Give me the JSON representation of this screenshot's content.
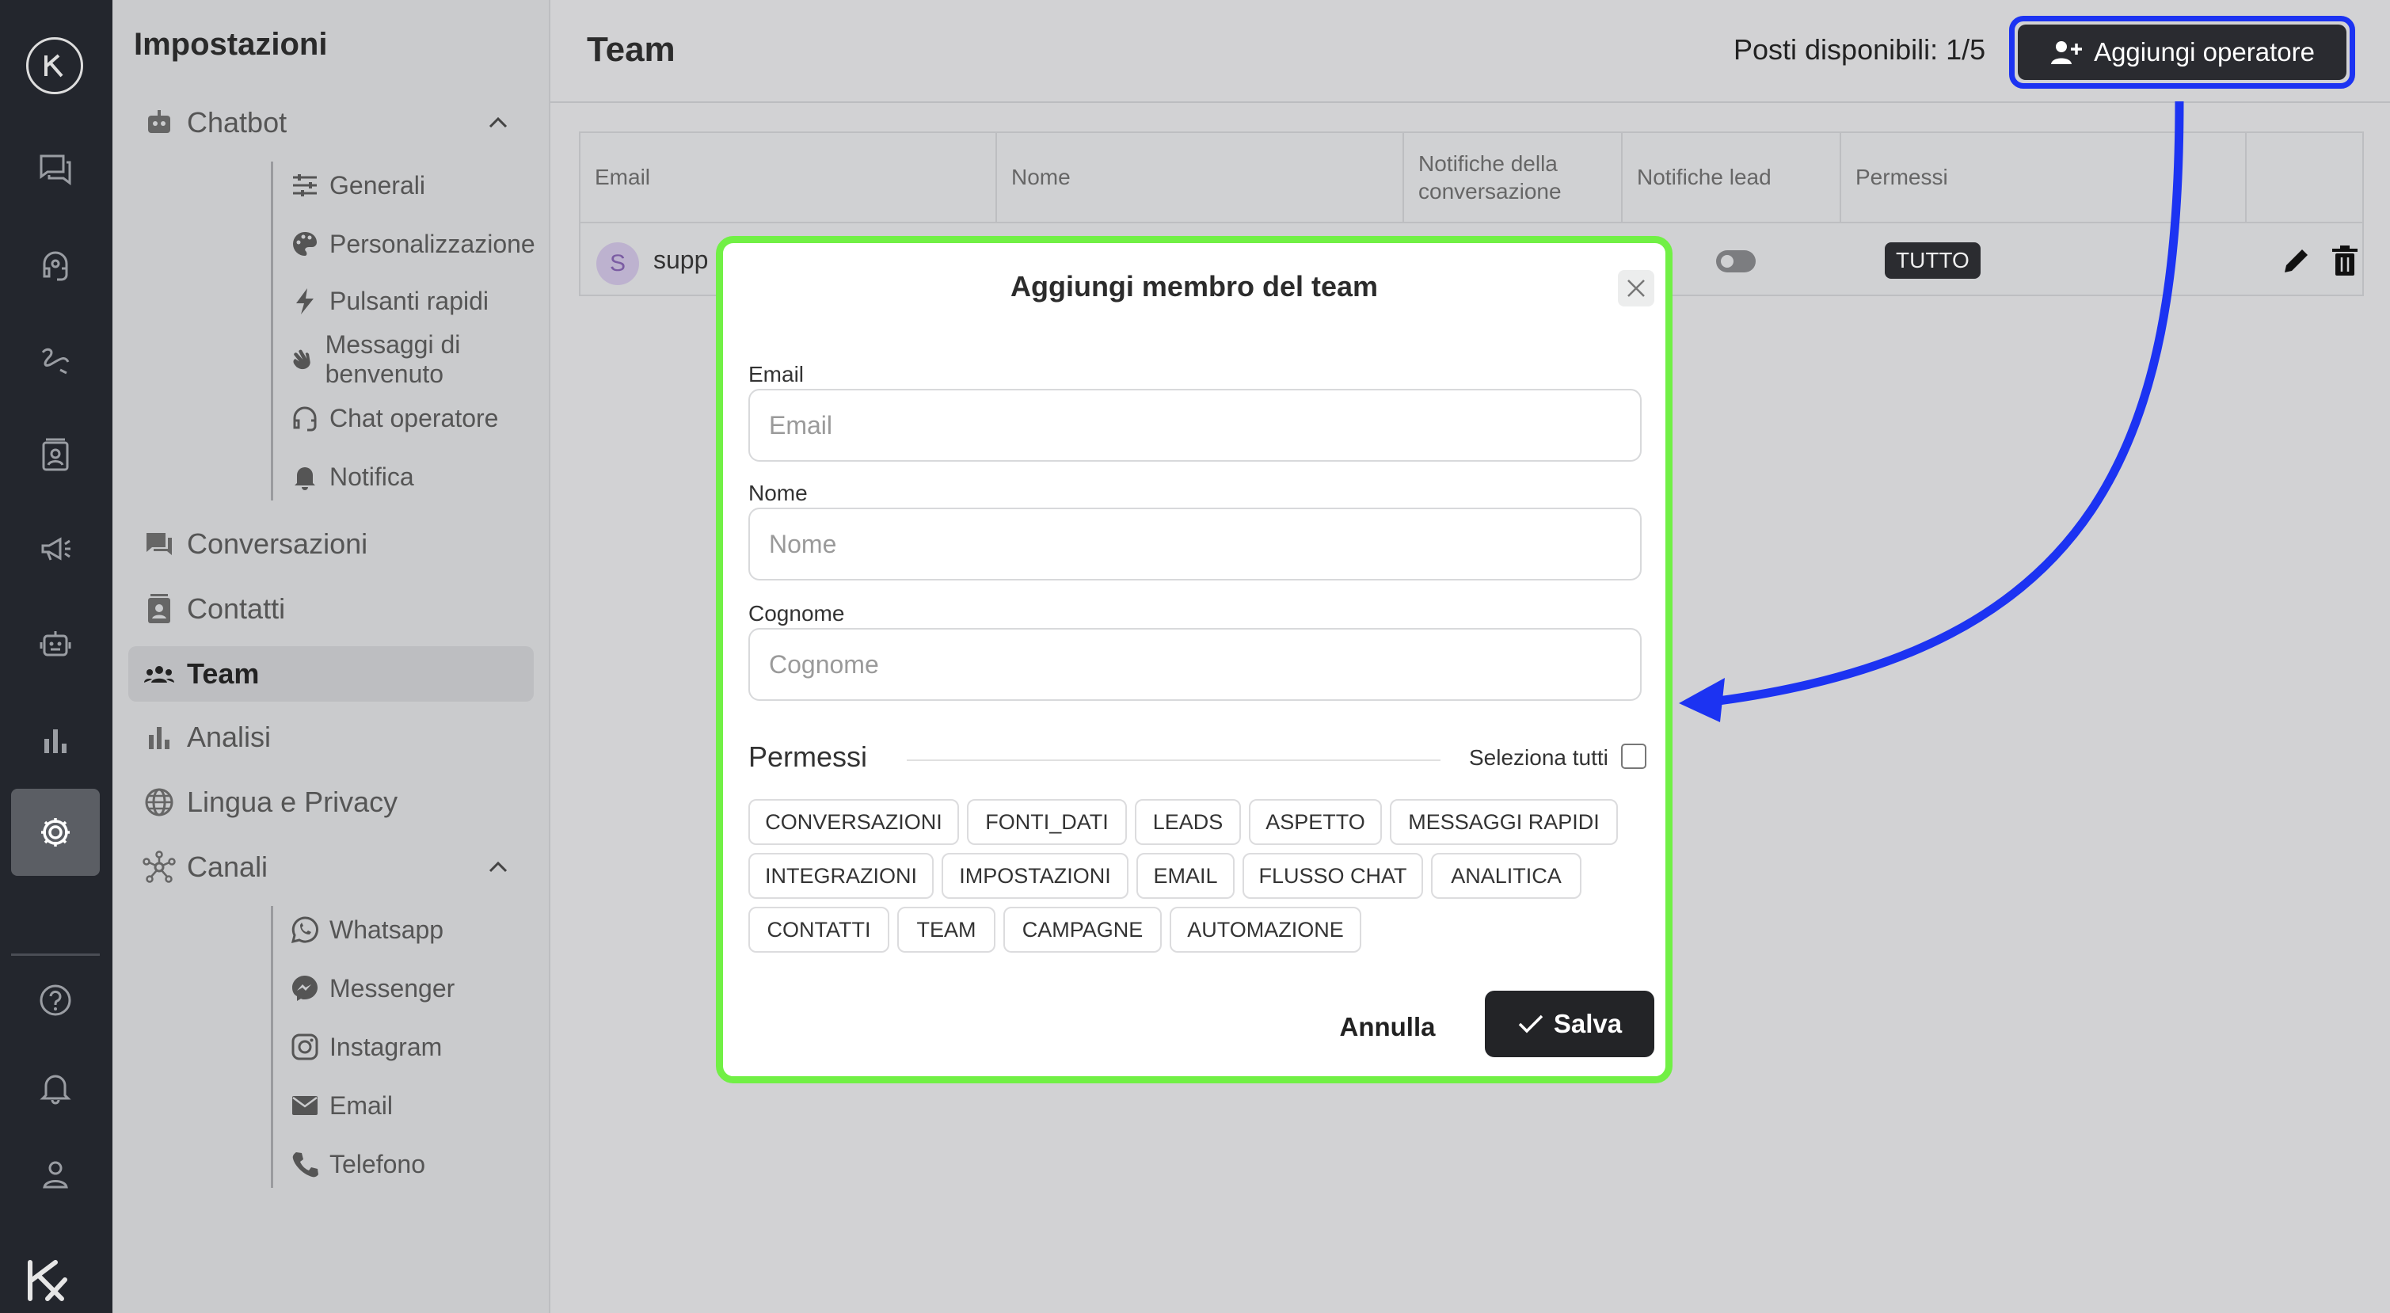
{
  "rail": {
    "logo_text": "Kalpha",
    "items": [
      "chat-bubbles-icon",
      "headset-icon",
      "scribble-icon",
      "contact-card-icon",
      "megaphone-icon",
      "robot-icon",
      "bar-chart-icon",
      "gear-icon",
      "help-icon",
      "bell-icon",
      "user-icon"
    ]
  },
  "sidebar": {
    "title": "Impostazioni",
    "chatbot": {
      "label": "Chatbot",
      "items": [
        "Generali",
        "Personalizzazione",
        "Pulsanti rapidi",
        "Messaggi di benvenuto",
        "Chat operatore",
        "Notifica"
      ]
    },
    "items": [
      "Conversazioni",
      "Contatti",
      "Team",
      "Analisi",
      "Lingua e Privacy"
    ],
    "active": "Team",
    "canali": {
      "label": "Canali",
      "items": [
        "Whatsapp",
        "Messenger",
        "Instagram",
        "Email",
        "Telefono"
      ]
    }
  },
  "header": {
    "title": "Team",
    "seats": "Posti disponibili: 1/5",
    "add_button": "Aggiungi operatore"
  },
  "table": {
    "columns": [
      "Email",
      "Nome",
      "Notifiche della conversazione",
      "Notifiche lead",
      "Permessi",
      ""
    ],
    "rows": [
      {
        "avatar": "S",
        "email": "supp",
        "lead_notifications": false,
        "permission": "TUTTO"
      }
    ]
  },
  "modal": {
    "title": "Aggiungi membro del team",
    "email_label": "Email",
    "email_placeholder": "Email",
    "name_label": "Nome",
    "name_placeholder": "Nome",
    "surname_label": "Cognome",
    "surname_placeholder": "Cognome",
    "permissions_title": "Permessi",
    "select_all": "Seleziona tutti",
    "permissions": [
      "CONVERSAZIONI",
      "FONTI_DATI",
      "LEADS",
      "ASPETTO",
      "MESSAGGI RAPIDI",
      "INTEGRAZIONI",
      "IMPOSTAZIONI",
      "EMAIL",
      "FLUSSO CHAT",
      "ANALITICA",
      "CONTATTI",
      "TEAM",
      "CAMPAGNE",
      "AUTOMAZIONE"
    ],
    "cancel": "Annulla",
    "save": "Salva"
  },
  "colors": {
    "highlight_button": "#1c33f2",
    "highlight_modal": "#71f045",
    "arrow": "#1c33f2"
  }
}
